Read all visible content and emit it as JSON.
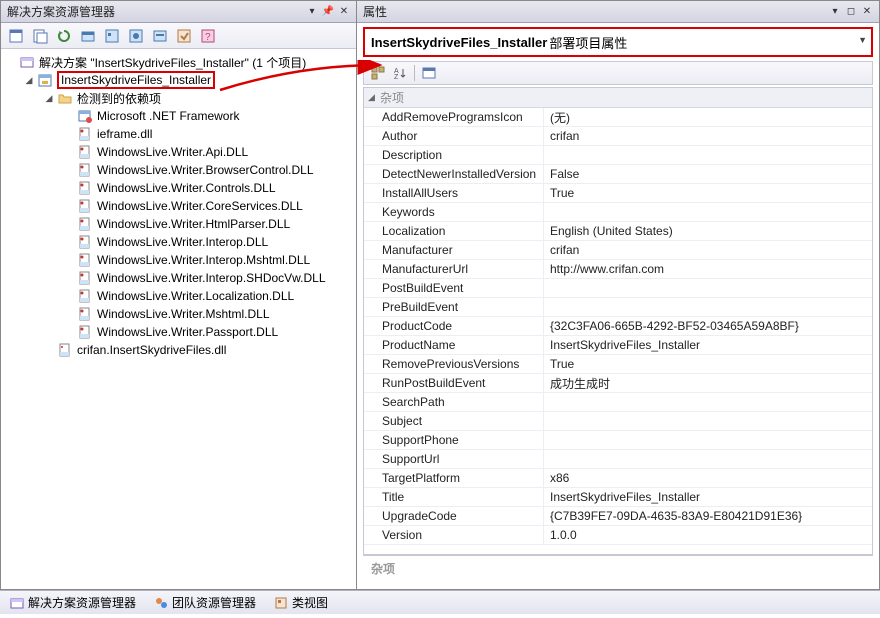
{
  "left": {
    "title": "解决方案资源管理器",
    "solution_line": "解决方案 \"InsertSkydriveFiles_Installer\" (1 个项目)",
    "project": "InsertSkydriveFiles_Installer",
    "deps_folder": "检测到的依赖项",
    "deps": [
      "Microsoft .NET Framework",
      "ieframe.dll",
      "WindowsLive.Writer.Api.DLL",
      "WindowsLive.Writer.BrowserControl.DLL",
      "WindowsLive.Writer.Controls.DLL",
      "WindowsLive.Writer.CoreServices.DLL",
      "WindowsLive.Writer.HtmlParser.DLL",
      "WindowsLive.Writer.Interop.DLL",
      "WindowsLive.Writer.Interop.Mshtml.DLL",
      "WindowsLive.Writer.Interop.SHDocVw.DLL",
      "WindowsLive.Writer.Localization.DLL",
      "WindowsLive.Writer.Mshtml.DLL",
      "WindowsLive.Writer.Passport.DLL"
    ],
    "primary_output": "crifan.InsertSkydriveFiles.dll"
  },
  "right": {
    "title": "属性",
    "header_bold": "InsertSkydriveFiles_Installer",
    "header_sub": "部署项目属性",
    "category": "杂项",
    "footer_label": "杂项",
    "props": [
      {
        "k": "AddRemoveProgramsIcon",
        "v": "(无)"
      },
      {
        "k": "Author",
        "v": "crifan"
      },
      {
        "k": "Description",
        "v": ""
      },
      {
        "k": "DetectNewerInstalledVersion",
        "v": "False"
      },
      {
        "k": "InstallAllUsers",
        "v": "True"
      },
      {
        "k": "Keywords",
        "v": ""
      },
      {
        "k": "Localization",
        "v": "English (United States)"
      },
      {
        "k": "Manufacturer",
        "v": "crifan"
      },
      {
        "k": "ManufacturerUrl",
        "v": "http://www.crifan.com"
      },
      {
        "k": "PostBuildEvent",
        "v": ""
      },
      {
        "k": "PreBuildEvent",
        "v": ""
      },
      {
        "k": "ProductCode",
        "v": "{32C3FA06-665B-4292-BF52-03465A59A8BF}"
      },
      {
        "k": "ProductName",
        "v": "InsertSkydriveFiles_Installer"
      },
      {
        "k": "RemovePreviousVersions",
        "v": "True"
      },
      {
        "k": "RunPostBuildEvent",
        "v": "成功生成时"
      },
      {
        "k": "SearchPath",
        "v": ""
      },
      {
        "k": "Subject",
        "v": ""
      },
      {
        "k": "SupportPhone",
        "v": ""
      },
      {
        "k": "SupportUrl",
        "v": ""
      },
      {
        "k": "TargetPlatform",
        "v": "x86"
      },
      {
        "k": "Title",
        "v": "InsertSkydriveFiles_Installer"
      },
      {
        "k": "UpgradeCode",
        "v": "{C7B39FE7-09DA-4635-83A9-E80421D91E36}"
      },
      {
        "k": "Version",
        "v": "1.0.0"
      }
    ]
  },
  "tabs": {
    "solution": "解决方案资源管理器",
    "team": "团队资源管理器",
    "class": "类视图"
  }
}
